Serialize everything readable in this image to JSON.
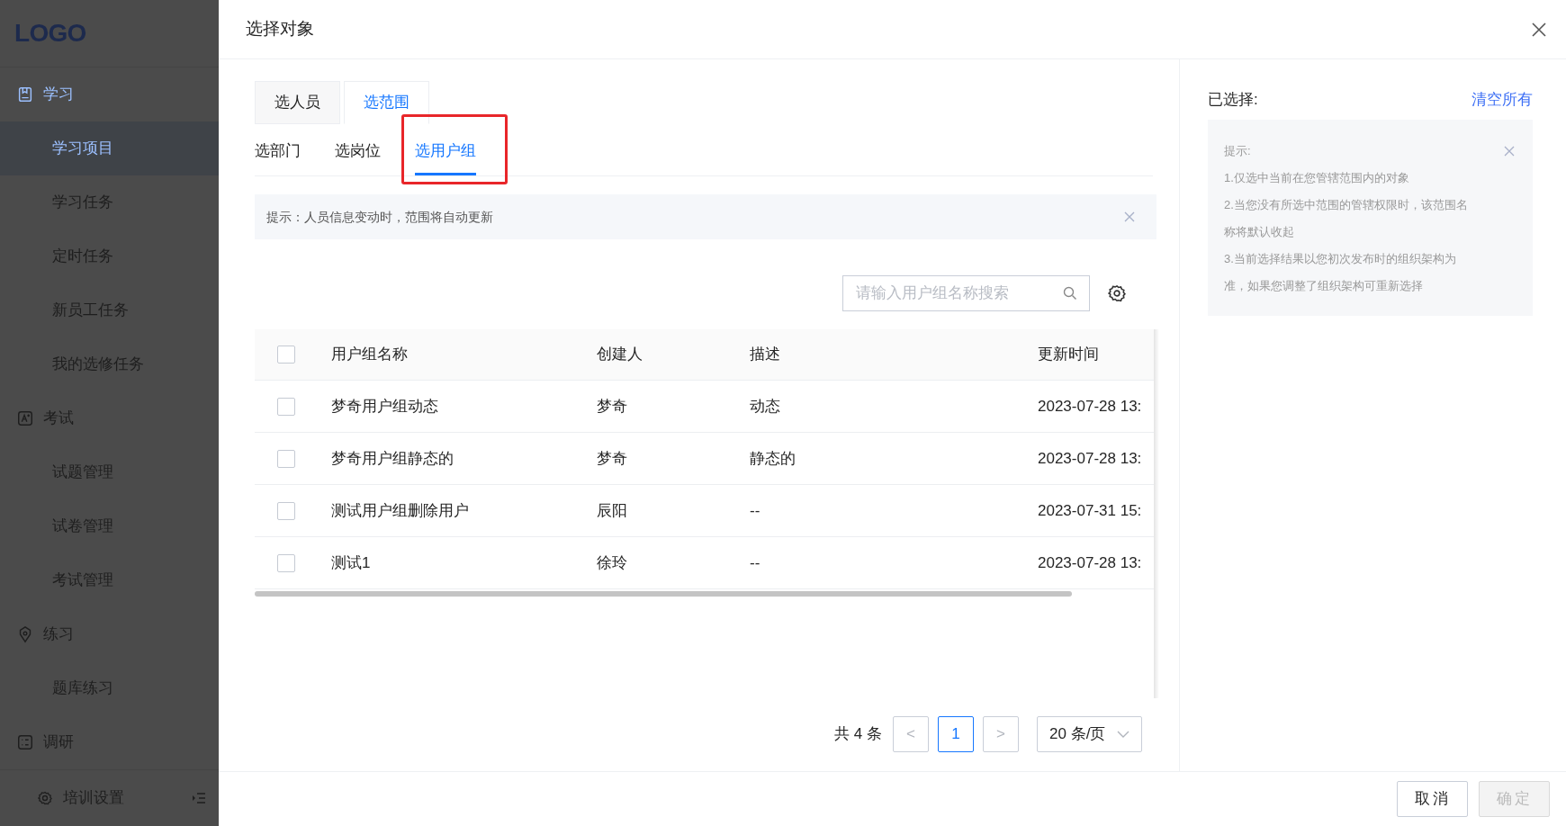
{
  "sidebar": {
    "logo": "LOGO",
    "groups": [
      {
        "label": "学习",
        "active": true,
        "items": [
          {
            "label": "学习项目",
            "selected": true
          },
          {
            "label": "学习任务",
            "selected": false
          },
          {
            "label": "定时任务",
            "selected": false
          },
          {
            "label": "新员工任务",
            "selected": false
          },
          {
            "label": "我的选修任务",
            "selected": false
          }
        ]
      },
      {
        "label": "考试",
        "active": false,
        "items": [
          {
            "label": "试题管理",
            "selected": false
          },
          {
            "label": "试卷管理",
            "selected": false
          },
          {
            "label": "考试管理",
            "selected": false
          }
        ]
      },
      {
        "label": "练习",
        "active": false,
        "items": [
          {
            "label": "题库练习",
            "selected": false
          }
        ]
      },
      {
        "label": "调研",
        "active": false
      }
    ],
    "footer": "培训设置"
  },
  "dialog": {
    "title": "选择对象",
    "tabs": [
      {
        "label": "选人员",
        "selected": false
      },
      {
        "label": "选范围",
        "selected": true
      }
    ],
    "subtabs": [
      {
        "label": "选部门",
        "selected": false,
        "highlighted": false
      },
      {
        "label": "选岗位",
        "selected": false,
        "highlighted": false
      },
      {
        "label": "选用户组",
        "selected": true,
        "highlighted": true
      }
    ],
    "alert": "提示：人员信息变动时，范围将自动更新",
    "search": {
      "placeholder": "请输入用户组名称搜索"
    },
    "table": {
      "select_all": {
        "checked": false
      },
      "columns": [
        "用户组名称",
        "创建人",
        "描述",
        "更新时间"
      ],
      "rows": [
        {
          "checked": false,
          "cells": [
            "梦奇用户组动态",
            "梦奇",
            "动态",
            "2023-07-28 13:"
          ]
        },
        {
          "checked": false,
          "cells": [
            "梦奇用户组静态的",
            "梦奇",
            "静态的",
            "2023-07-28 13:"
          ]
        },
        {
          "checked": false,
          "cells": [
            "测试用户组删除用户",
            "辰阳",
            "--",
            "2023-07-31 15:"
          ]
        },
        {
          "checked": false,
          "cells": [
            "测试1",
            "徐玲",
            "--",
            "2023-07-28 13:"
          ]
        }
      ]
    },
    "pagination": {
      "total": "共 4 条",
      "prev": "<",
      "pages": [
        {
          "label": "1",
          "selected": true
        }
      ],
      "next": ">",
      "page_size": "20 条/页"
    },
    "selected_panel": {
      "title": "已选择:",
      "clear": "清空所有",
      "tip_title": "提示:",
      "tip_lines": [
        "1.仅选中当前在您管辖范围内的对象",
        "2.当您没有所选中范围的管辖权限时，该范围名",
        "称将默认收起",
        "3.当前选择结果以您初次发布时的组织架构为",
        "准，如果您调整了组织架构可重新选择"
      ]
    },
    "buttons": [
      {
        "label": "取消",
        "disabled": false
      },
      {
        "label": "确定",
        "disabled": true
      }
    ]
  }
}
